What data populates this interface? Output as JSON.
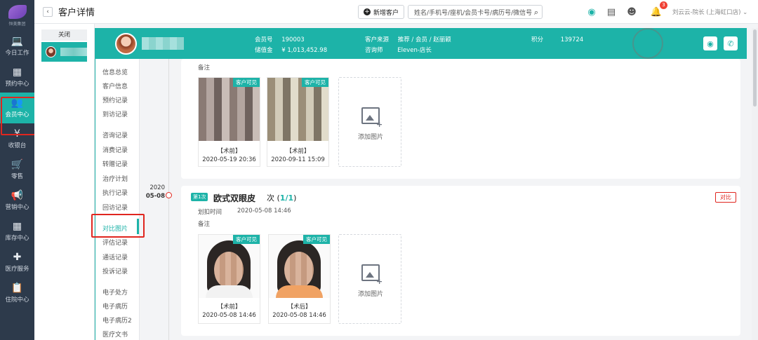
{
  "nav": {
    "logo_text": "恒美集团",
    "items": [
      {
        "label": "今日工作",
        "icon": "laptop-icon"
      },
      {
        "label": "预约中心",
        "icon": "calendar-icon"
      },
      {
        "label": "会员中心",
        "icon": "users-icon"
      },
      {
        "label": "收银台",
        "icon": "yen-icon"
      },
      {
        "label": "零售",
        "icon": "cart-icon"
      },
      {
        "label": "营销中心",
        "icon": "megaphone-icon"
      },
      {
        "label": "库存中心",
        "icon": "grid-icon"
      },
      {
        "label": "医疗服务",
        "icon": "medkit-icon"
      },
      {
        "label": "住院中心",
        "icon": "clipboard-icon"
      }
    ],
    "active_index": 2
  },
  "topbar": {
    "back": "‹",
    "title": "客户详情",
    "new_customer": "新增客户",
    "search_placeholder": "姓名/手机号/座机/会员卡号/病历号/微信号",
    "badge": "3",
    "user": "刘云云-院长 (上海虹口店)"
  },
  "subtabs": {
    "close": "关闭"
  },
  "customer": {
    "member_no_label": "会员号",
    "member_no": "190003",
    "balance_label": "储值金",
    "balance": "¥ 1,013,452.98",
    "source_label": "客户来源",
    "source": "推荐 / 会员 / 赵丽颖",
    "consultant_label": "咨询师",
    "consultant": "Eleven-店长",
    "points_label": "积分",
    "points": "139724"
  },
  "menu": {
    "items": [
      "信息总览",
      "客户信息",
      "预约记录",
      "到访记录",
      "咨询记录",
      "消费记录",
      "转赠记录",
      "治疗计划",
      "执行记录",
      "回访记录",
      "对比图片",
      "评估记录",
      "通话记录",
      "投诉记录",
      "电子处方",
      "电子病历",
      "电子病历2",
      "医疗文书"
    ],
    "active": "对比图片"
  },
  "timeline": {
    "year": "2020",
    "day": "05-08"
  },
  "card1": {
    "remark_label": "备注",
    "photos": [
      {
        "badge": "客户可见",
        "caption": "【术前】",
        "time": "2020-05-19 20:36"
      },
      {
        "badge": "客户可见",
        "caption": "【术前】",
        "time": "2020-09-11 15:09"
      }
    ],
    "add_label": "添加图片"
  },
  "card2": {
    "tag": "第1次",
    "title": "欧式双眼皮",
    "count_prefix": "次 (",
    "count_value": "1/1",
    "count_suffix": ")",
    "compare": "对比",
    "time_label": "划扣时间",
    "time_value": "2020-05-08 14:46",
    "remark_label": "备注",
    "photos": [
      {
        "badge": "客户可见",
        "caption": "【术前】",
        "time": "2020-05-08 14:46"
      },
      {
        "badge": "客户可见",
        "caption": "【术后】",
        "time": "2020-05-08 14:46"
      }
    ],
    "add_label": "添加图片"
  }
}
